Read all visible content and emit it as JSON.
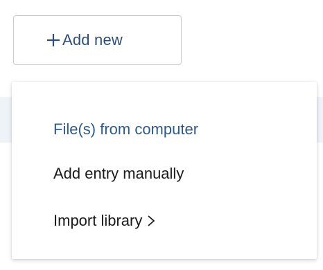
{
  "toolbar": {
    "add_new_label": "Add new",
    "add_new_icon": "plus-icon"
  },
  "menu": {
    "items": [
      {
        "label": "File(s) from computer",
        "highlighted": true
      },
      {
        "label": "Add entry manually",
        "highlighted": false
      },
      {
        "label": "Import library",
        "has_submenu": true,
        "icon": "chevron-right-icon"
      }
    ]
  },
  "colors": {
    "accent": "#2b4f7a",
    "highlight": "#2b5a8e",
    "text": "#1a1a1a",
    "border": "#c7cacf"
  }
}
